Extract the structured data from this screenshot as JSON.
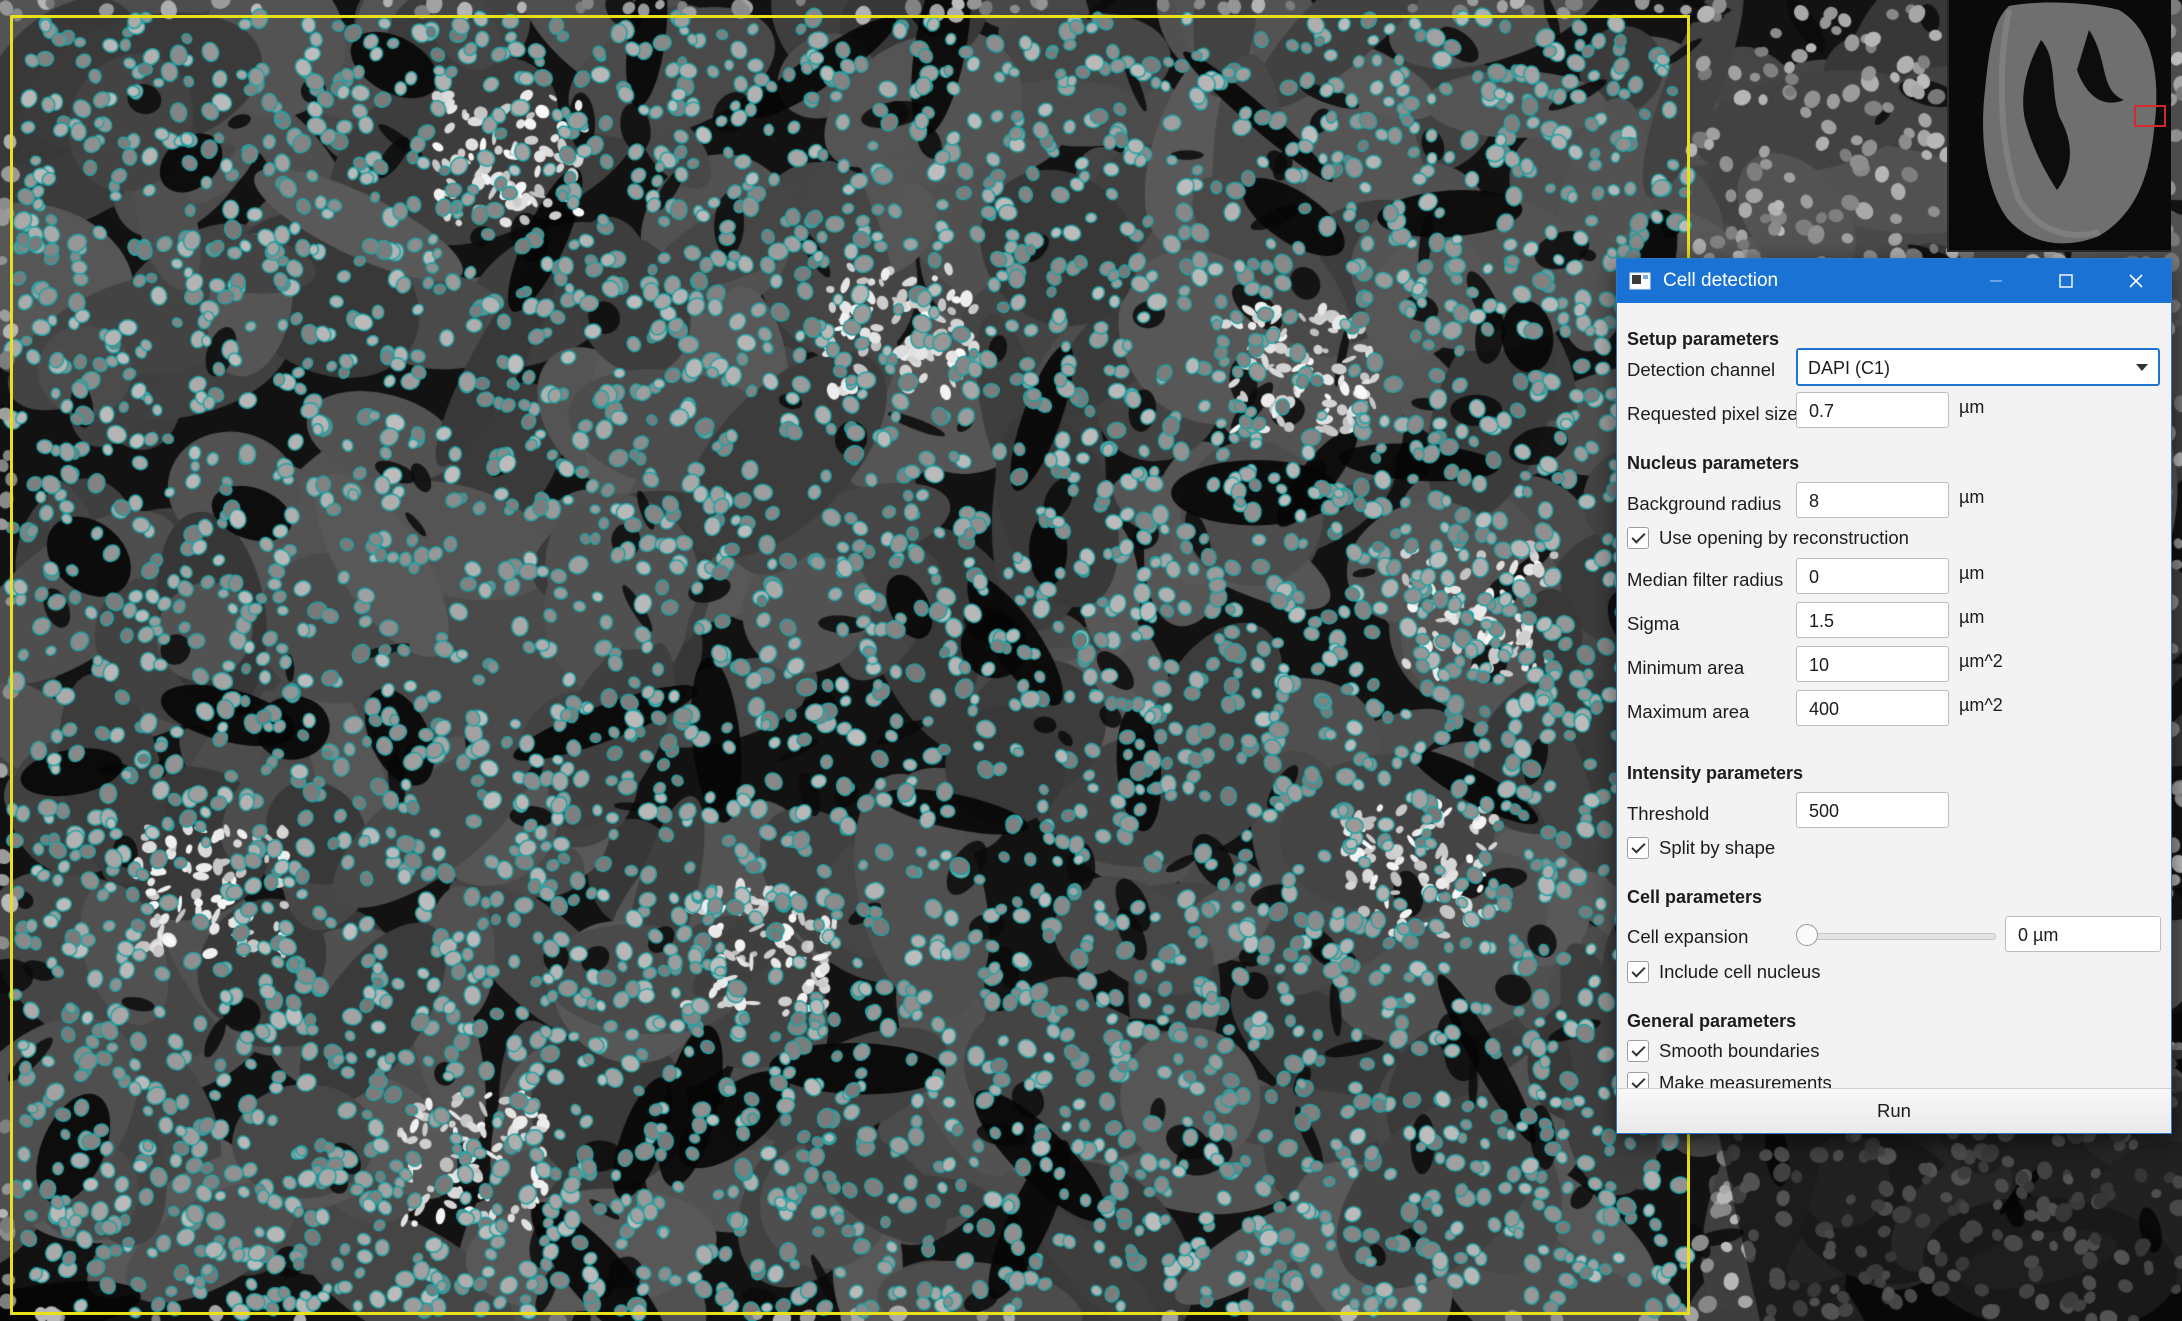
{
  "dialog": {
    "title": "Cell detection",
    "title_controls": [
      "minimize",
      "maximize",
      "close"
    ],
    "setup": {
      "heading": "Setup parameters",
      "detection_channel_label": "Detection channel",
      "detection_channel_value": "DAPI (C1)",
      "pixel_size_label": "Requested pixel size",
      "pixel_size_value": "0.7",
      "pixel_size_unit": "µm"
    },
    "nucleus": {
      "heading": "Nucleus parameters",
      "background_radius_label": "Background radius",
      "background_radius_value": "8",
      "background_radius_unit": "µm",
      "opening_label": "Use opening by reconstruction",
      "opening_checked": true,
      "median_label": "Median filter radius",
      "median_value": "0",
      "median_unit": "µm",
      "sigma_label": "Sigma",
      "sigma_value": "1.5",
      "sigma_unit": "µm",
      "min_area_label": "Minimum area",
      "min_area_value": "10",
      "min_area_unit": "µm^2",
      "max_area_label": "Maximum area",
      "max_area_value": "400",
      "max_area_unit": "µm^2"
    },
    "intensity": {
      "heading": "Intensity parameters",
      "threshold_label": "Threshold",
      "threshold_value": "500",
      "split_label": "Split by shape",
      "split_checked": true
    },
    "cell": {
      "heading": "Cell parameters",
      "expansion_label": "Cell expansion",
      "expansion_value": "0 µm",
      "expansion_slider_fraction": 0,
      "include_nucleus_label": "Include cell nucleus",
      "include_nucleus_checked": true
    },
    "general": {
      "heading": "General parameters",
      "smooth_label": "Smooth boundaries",
      "smooth_checked": true,
      "measure_label": "Make measurements",
      "measure_checked": true
    },
    "run_label": "Run"
  },
  "colors": {
    "roi": "#e8e01a",
    "cell_outline": "#1fa3a3",
    "title_bar": "#1a73d4",
    "overview_marker": "#d12b2b"
  }
}
